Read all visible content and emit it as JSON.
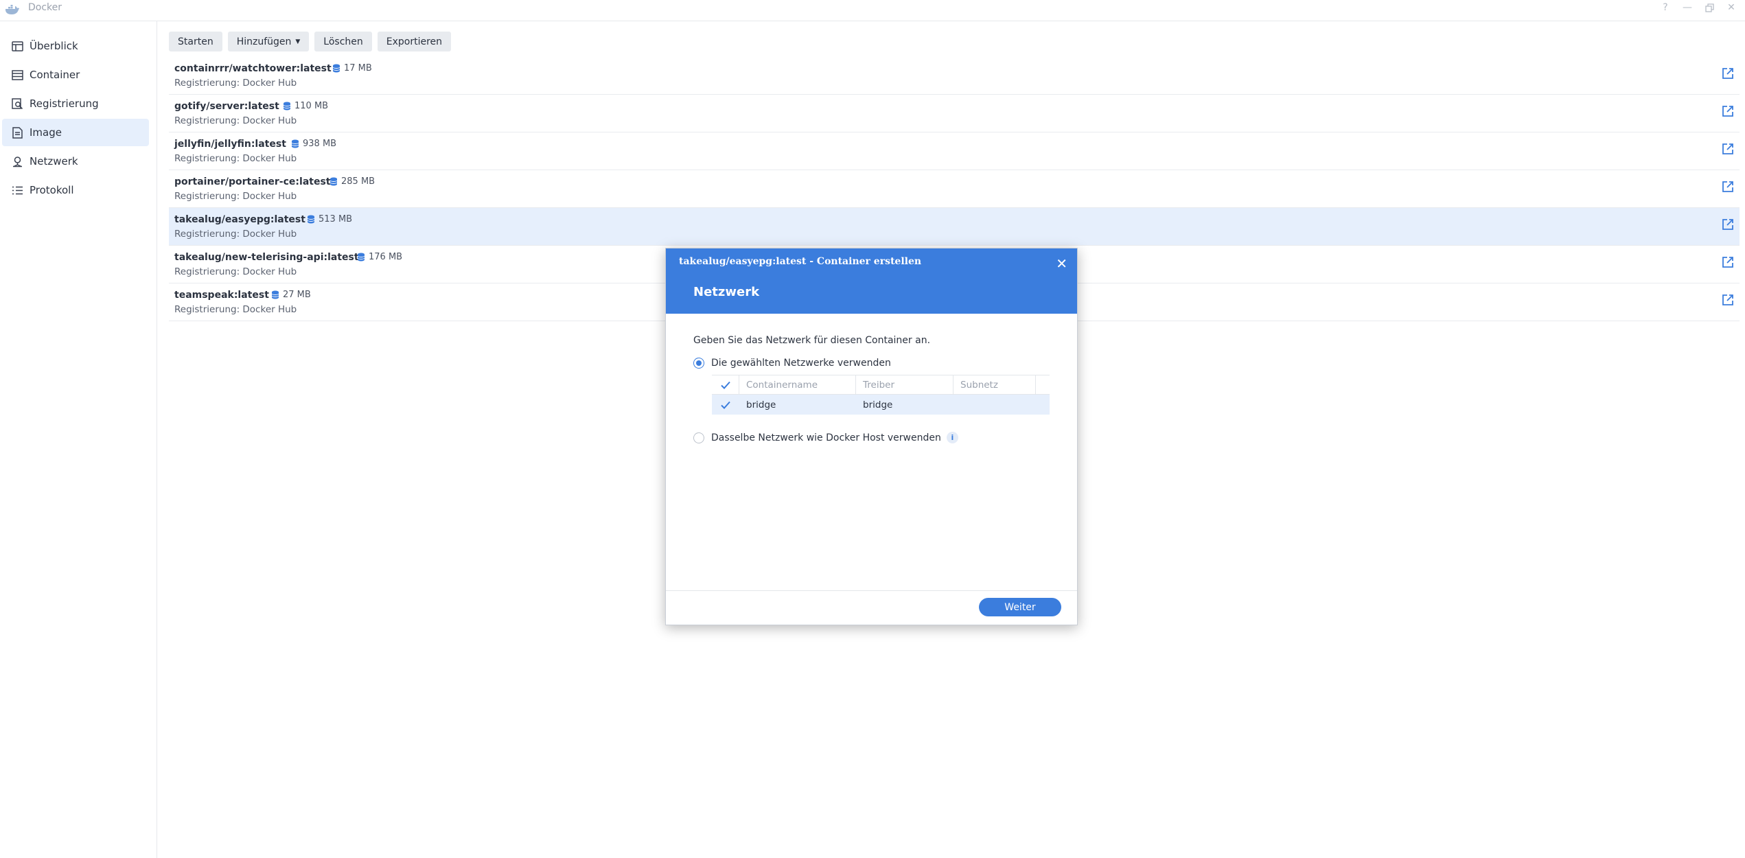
{
  "window": {
    "title": "Docker"
  },
  "sidebar": {
    "items": [
      {
        "label": "Überblick",
        "icon": "overview-icon"
      },
      {
        "label": "Container",
        "icon": "container-icon"
      },
      {
        "label": "Registrierung",
        "icon": "registry-icon"
      },
      {
        "label": "Image",
        "icon": "image-icon",
        "active": true
      },
      {
        "label": "Netzwerk",
        "icon": "network-icon"
      },
      {
        "label": "Protokoll",
        "icon": "log-icon"
      }
    ]
  },
  "toolbar": {
    "start_label": "Starten",
    "add_label": "Hinzufügen",
    "delete_label": "Löschen",
    "export_label": "Exportieren"
  },
  "images": [
    {
      "name": "containrrr/watchtower:latest",
      "size": "17 MB",
      "registry": "Registrierung: Docker Hub"
    },
    {
      "name": "gotify/server:latest",
      "size": "110 MB",
      "registry": "Registrierung: Docker Hub"
    },
    {
      "name": "jellyfin/jellyfin:latest",
      "size": "938 MB",
      "registry": "Registrierung: Docker Hub"
    },
    {
      "name": "portainer/portainer-ce:latest",
      "size": "285 MB",
      "registry": "Registrierung: Docker Hub"
    },
    {
      "name": "takealug/easyepg:latest",
      "size": "513 MB",
      "registry": "Registrierung: Docker Hub",
      "selected": true
    },
    {
      "name": "takealug/new-telerising-api:latest",
      "size": "176 MB",
      "registry": "Registrierung: Docker Hub"
    },
    {
      "name": "teamspeak:latest",
      "size": "27 MB",
      "registry": "Registrierung: Docker Hub"
    }
  ],
  "dialog": {
    "title": "takealug/easyepg:latest - Container erstellen",
    "step": "Netzwerk",
    "description": "Geben Sie das Netzwerk für diesen Container an.",
    "option_selected": "Die gewählten Netzwerke verwenden",
    "option_host": "Dasselbe Netzwerk wie Docker Host verwenden",
    "table": {
      "headers": [
        "Containername",
        "Treiber",
        "Subnetz"
      ],
      "rows": [
        {
          "name": "bridge",
          "driver": "bridge",
          "subnet": ""
        }
      ]
    },
    "next_label": "Weiter"
  },
  "colors": {
    "accent": "#3b7ddd",
    "selection": "#e6effc"
  }
}
